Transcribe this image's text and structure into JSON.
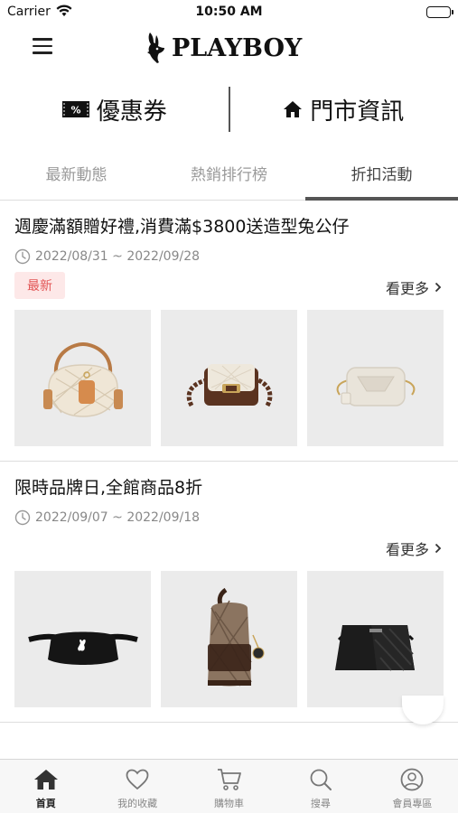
{
  "status_bar": {
    "carrier": "Carrier",
    "time": "10:50 AM"
  },
  "header": {
    "brand": "PLAYBOY",
    "menu_icon": "hamburger-menu-icon"
  },
  "quick_links": [
    {
      "label": "優惠券",
      "icon": "coupon-icon"
    },
    {
      "label": "門市資訊",
      "icon": "home-icon"
    }
  ],
  "tabs": [
    {
      "label": "最新動態",
      "active": false
    },
    {
      "label": "熱銷排行榜",
      "active": false
    },
    {
      "label": "折扣活動",
      "active": true
    }
  ],
  "promotions": [
    {
      "title": "週慶滿額贈好禮,消費滿$3800送造型兔公仔",
      "date_range": "2022/08/31 ~ 2022/09/28",
      "badge": "最新",
      "see_more": "看更多",
      "products": [
        "quilted-saddle-bag",
        "quilted-flap-bag",
        "ivory-camera-bag"
      ]
    },
    {
      "title": "限時品牌日,全館商品8折",
      "date_range": "2022/09/07 ~ 2022/09/18",
      "see_more": "看更多",
      "products": [
        "black-belt-bag",
        "monogram-sling-bag",
        "black-messenger-bag"
      ]
    }
  ],
  "tabbar": [
    {
      "label": "首頁",
      "icon": "home-icon",
      "active": true
    },
    {
      "label": "我的收藏",
      "icon": "heart-icon",
      "active": false
    },
    {
      "label": "購物車",
      "icon": "cart-icon",
      "active": false
    },
    {
      "label": "搜尋",
      "icon": "search-icon",
      "active": false
    },
    {
      "label": "會員專區",
      "icon": "user-icon",
      "active": false
    }
  ],
  "colors": {
    "badge_bg": "#fde8e8",
    "badge_text": "#e25555",
    "tab_indicator": "#555555",
    "product_bg": "#ebebeb"
  }
}
